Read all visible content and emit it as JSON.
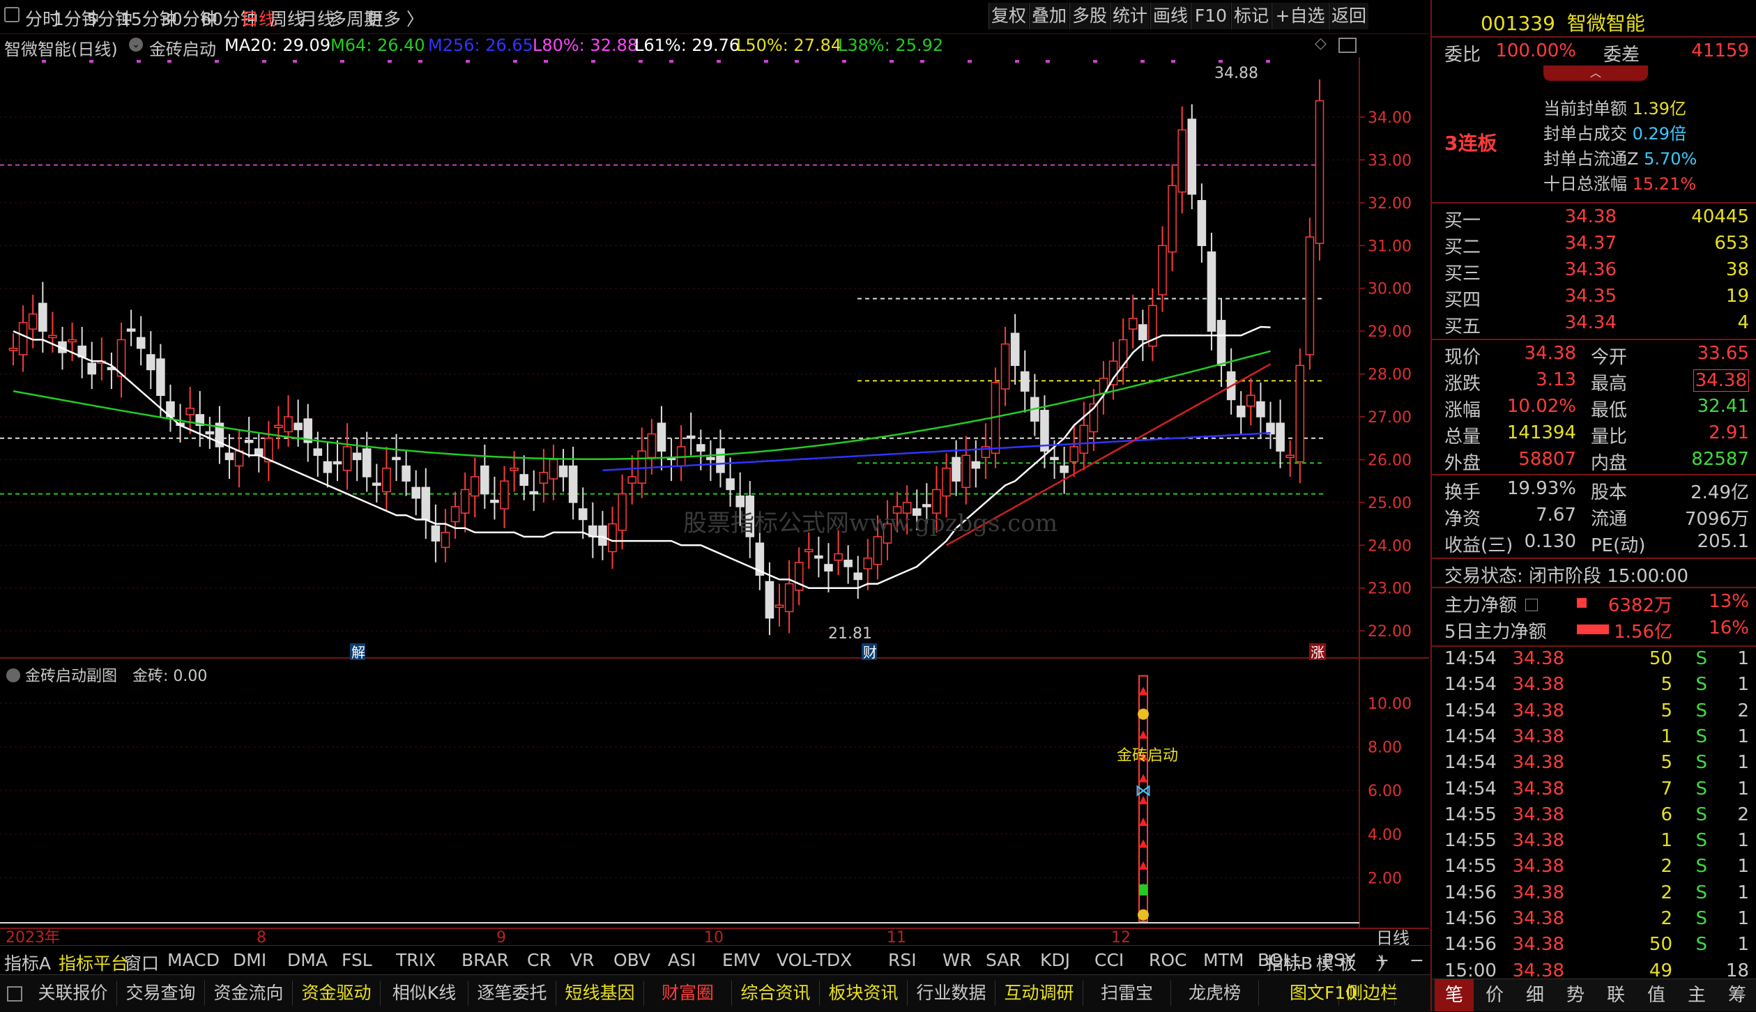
{
  "toolbar": {
    "periods": [
      "分时",
      "1分钟",
      "5分钟",
      "15分钟",
      "30分钟",
      "60分钟",
      "日线",
      "周线",
      "月线",
      "多周期",
      "更多 〉"
    ],
    "active_period": "日线",
    "buttons": [
      "复权",
      "叠加",
      "多股",
      "统计",
      "画线",
      "F10",
      "标记",
      "+自选",
      "返回"
    ]
  },
  "info": {
    "stock_label": "智微智能(日线)",
    "indicator": "金砖启动",
    "ma20": "MA20: 29.09",
    "m64": "M64: 26.40",
    "m256": "M256: 26.65",
    "l80": "L80%: 32.88",
    "l61": "L61%: 29.76",
    "l50": "L50%: 27.84",
    "l38": "L38%: 25.92"
  },
  "chart_data": [
    {
      "type": "candlestick",
      "title": "智微智能(日线)",
      "y_ticks": [
        "34.00",
        "33.00",
        "32.00",
        "31.00",
        "30.00",
        "29.00",
        "28.00",
        "27.00",
        "26.00",
        "25.00",
        "24.00",
        "23.00",
        "22.00"
      ],
      "ylim": [
        21.4,
        35.4
      ],
      "annotations": {
        "high": "34.88",
        "low": "21.81"
      },
      "markers": [
        "解",
        "财",
        "涨"
      ],
      "x_labels": [
        "2023年",
        "8",
        "9",
        "10",
        "11",
        "12"
      ],
      "closes": [
        28.6,
        29.2,
        29.4,
        29.0,
        28.9,
        28.5,
        28.8,
        28.4,
        28.0,
        28.3,
        28.1,
        28.8,
        29.0,
        28.6,
        28.1,
        27.5,
        27.0,
        26.8,
        27.2,
        26.8,
        26.6,
        26.3,
        26.0,
        26.2,
        26.4,
        26.1,
        26.5,
        26.8,
        27.0,
        26.7,
        26.4,
        26.1,
        25.7,
        25.9,
        26.3,
        26.0,
        25.6,
        25.4,
        25.8,
        26.0,
        25.5,
        25.1,
        24.6,
        24.1,
        24.3,
        24.9,
        25.3,
        25.6,
        25.2,
        25.0,
        25.5,
        25.8,
        25.4,
        25.2,
        25.7,
        26.0,
        25.6,
        25.0,
        24.6,
        24.2,
        24.0,
        24.5,
        25.2,
        25.6,
        26.2,
        26.6,
        26.2,
        26.0,
        26.3,
        26.5,
        26.2,
        26.0,
        25.7,
        25.3,
        24.9,
        24.2,
        23.3,
        22.3,
        22.6,
        23.1,
        23.6,
        23.9,
        23.7,
        23.4,
        23.8,
        23.5,
        23.2,
        23.7,
        24.2,
        24.5,
        24.9,
        25.0,
        24.7,
        24.9,
        25.3,
        25.8,
        25.5,
        26.1,
        25.8,
        26.3,
        27.8,
        28.7,
        28.2,
        27.6,
        26.9,
        26.2,
        26.0,
        25.7,
        26.3,
        26.8,
        27.3,
        27.9,
        28.3,
        28.8,
        29.3,
        28.8,
        29.6,
        31.0,
        32.4,
        33.7,
        32.2,
        31.0,
        29.0,
        28.2,
        27.4,
        27.0,
        27.5,
        27.0,
        26.6,
        26.2,
        26.1,
        28.2,
        31.2,
        34.38
      ],
      "ma20": [
        29.0,
        28.9,
        28.8,
        28.8,
        28.7,
        28.6,
        28.5,
        28.4,
        28.3,
        28.3,
        28.2,
        28.0,
        27.8,
        27.6,
        27.4,
        27.2,
        27.0,
        26.8,
        26.7,
        26.6,
        26.5,
        26.4,
        26.3,
        26.2,
        26.1,
        26.1,
        26.0,
        25.9,
        25.8,
        25.7,
        25.6,
        25.5,
        25.4,
        25.3,
        25.2,
        25.1,
        25.0,
        24.9,
        24.8,
        24.7,
        24.7,
        24.6,
        24.6,
        24.5,
        24.5,
        24.4,
        24.4,
        24.3,
        24.3,
        24.3,
        24.3,
        24.3,
        24.2,
        24.2,
        24.2,
        24.3,
        24.3,
        24.3,
        24.3,
        24.2,
        24.2,
        24.1,
        24.1,
        24.1,
        24.1,
        24.1,
        24.1,
        24.1,
        24.0,
        24.0,
        24.0,
        23.9,
        23.8,
        23.7,
        23.6,
        23.5,
        23.4,
        23.3,
        23.2,
        23.2,
        23.1,
        23.0,
        23.0,
        23.0,
        23.0,
        23.0,
        23.0,
        23.1,
        23.1,
        23.2,
        23.3,
        23.4,
        23.5,
        23.7,
        23.9,
        24.1,
        24.4,
        24.6,
        24.8,
        25.0,
        25.2,
        25.4,
        25.5,
        25.7,
        25.9,
        26.1,
        26.3,
        26.5,
        26.8,
        27.0,
        27.2,
        27.5,
        27.9,
        28.2,
        28.5,
        28.7,
        28.8,
        28.9,
        28.9,
        28.9,
        28.9,
        28.9,
        28.9,
        28.9,
        28.9,
        28.9,
        29.0,
        29.1,
        29.09
      ]
    },
    {
      "type": "bar",
      "title": "金砖启动副图",
      "value_label": "金砖: 0.00",
      "y_ticks": [
        "10.00",
        "8.00",
        "6.00",
        "4.00",
        "2.00"
      ],
      "ylim": [
        0,
        11.5
      ],
      "signal_label": "金砖启动",
      "signal_value": 11
    }
  ],
  "indicator_tabs": [
    "指标A",
    "指标平台",
    "窗口",
    "MACD",
    "DMI",
    "DMA",
    "FSL",
    "TRIX",
    "BRAR",
    "CR",
    "VR",
    "OBV",
    "ASI",
    "EMV",
    "VOL-TDX",
    "RSI",
    "WR",
    "SAR",
    "KDJ",
    "CCI",
    "ROC",
    "MTM",
    "BOLL",
    "PSY",
    "〉"
  ],
  "indicator_right": [
    "指标B",
    "模 板",
    "+",
    "−"
  ],
  "period_label": "日线",
  "function_tabs": [
    "关联报价",
    "交易查询",
    "资金流向",
    "资金驱动",
    "相似K线",
    "逐笔委托",
    "短线基因",
    "财富圈",
    "综合资讯",
    "板块资讯",
    "行业数据",
    "互动调研",
    "扫雷宝",
    "龙虎榜",
    "图文F10",
    "侧边栏"
  ],
  "quote": {
    "code": "001339",
    "name": "智微智能",
    "weibi_label": "委比",
    "weibi": "100.00%",
    "weicha_label": "委差",
    "weicha": "41159",
    "board": "3连板",
    "seal_amount_label": "当前封单额",
    "seal_amount": "1.39亿",
    "seal_ratio_label": "封单占成交",
    "seal_ratio": "0.29倍",
    "seal_float_label": "封单占流通Z",
    "seal_float": "5.70%",
    "ten_day_label": "十日总涨幅",
    "ten_day": "15.21%",
    "bids": [
      {
        "label": "买一",
        "price": "34.38",
        "vol": "40445"
      },
      {
        "label": "买二",
        "price": "34.37",
        "vol": "653"
      },
      {
        "label": "买三",
        "price": "34.36",
        "vol": "38"
      },
      {
        "label": "买四",
        "price": "34.35",
        "vol": "19"
      },
      {
        "label": "买五",
        "price": "34.34",
        "vol": "4"
      }
    ],
    "stats": [
      {
        "l1": "现价",
        "v1": "34.38",
        "l2": "今开",
        "v2": "33.65"
      },
      {
        "l1": "涨跌",
        "v1": "3.13",
        "l2": "最高",
        "v2": "34.38"
      },
      {
        "l1": "涨幅",
        "v1": "10.02%",
        "l2": "最低",
        "v2": "32.41"
      },
      {
        "l1": "总量",
        "v1": "141394",
        "l2": "量比",
        "v2": "2.91"
      },
      {
        "l1": "外盘",
        "v1": "58807",
        "l2": "内盘",
        "v2": "82587"
      }
    ],
    "fund": [
      {
        "l1": "换手",
        "v1": "19.93%",
        "l2": "股本",
        "v2": "2.49亿"
      },
      {
        "l1": "净资",
        "v1": "7.67",
        "l2": "流通",
        "v2": "7096万"
      },
      {
        "l1": "收益(三)",
        "v1": "0.130",
        "l2": "PE(动)",
        "v2": "205.1"
      }
    ],
    "trade_status": "交易状态: 闭市阶段 15:00:00",
    "main_net_label": "主力净额",
    "main_net": "6382万",
    "main_net_pct": "13%",
    "main5_label": "5日主力净额",
    "main5": "1.56亿",
    "main5_pct": "16%",
    "ticks": [
      {
        "t": "14:54",
        "p": "34.38",
        "v": "50",
        "s": "S",
        "n": "1"
      },
      {
        "t": "14:54",
        "p": "34.38",
        "v": "5",
        "s": "S",
        "n": "1"
      },
      {
        "t": "14:54",
        "p": "34.38",
        "v": "5",
        "s": "S",
        "n": "2"
      },
      {
        "t": "14:54",
        "p": "34.38",
        "v": "1",
        "s": "S",
        "n": "1"
      },
      {
        "t": "14:54",
        "p": "34.38",
        "v": "5",
        "s": "S",
        "n": "1"
      },
      {
        "t": "14:54",
        "p": "34.38",
        "v": "7",
        "s": "S",
        "n": "1"
      },
      {
        "t": "14:55",
        "p": "34.38",
        "v": "6",
        "s": "S",
        "n": "2"
      },
      {
        "t": "14:55",
        "p": "34.38",
        "v": "1",
        "s": "S",
        "n": "1"
      },
      {
        "t": "14:55",
        "p": "34.38",
        "v": "2",
        "s": "S",
        "n": "1"
      },
      {
        "t": "14:56",
        "p": "34.38",
        "v": "2",
        "s": "S",
        "n": "1"
      },
      {
        "t": "14:56",
        "p": "34.38",
        "v": "2",
        "s": "S",
        "n": "1"
      },
      {
        "t": "14:56",
        "p": "34.38",
        "v": "50",
        "s": "S",
        "n": "1"
      },
      {
        "t": "15:00",
        "p": "34.38",
        "v": "49",
        "s": "",
        "n": "18"
      }
    ],
    "bottom_tabs": [
      "笔",
      "价",
      "细",
      "势",
      "联",
      "值",
      "主",
      "筹"
    ]
  },
  "watermark": "股票指标公式网www.gpzbgs.com",
  "colors": {
    "up": "#ff3b3b",
    "down": "#3ddc3d",
    "accent": "#e8e020",
    "ma20": "#ffffff",
    "m64": "#22cc22",
    "m256": "#3333ff"
  }
}
